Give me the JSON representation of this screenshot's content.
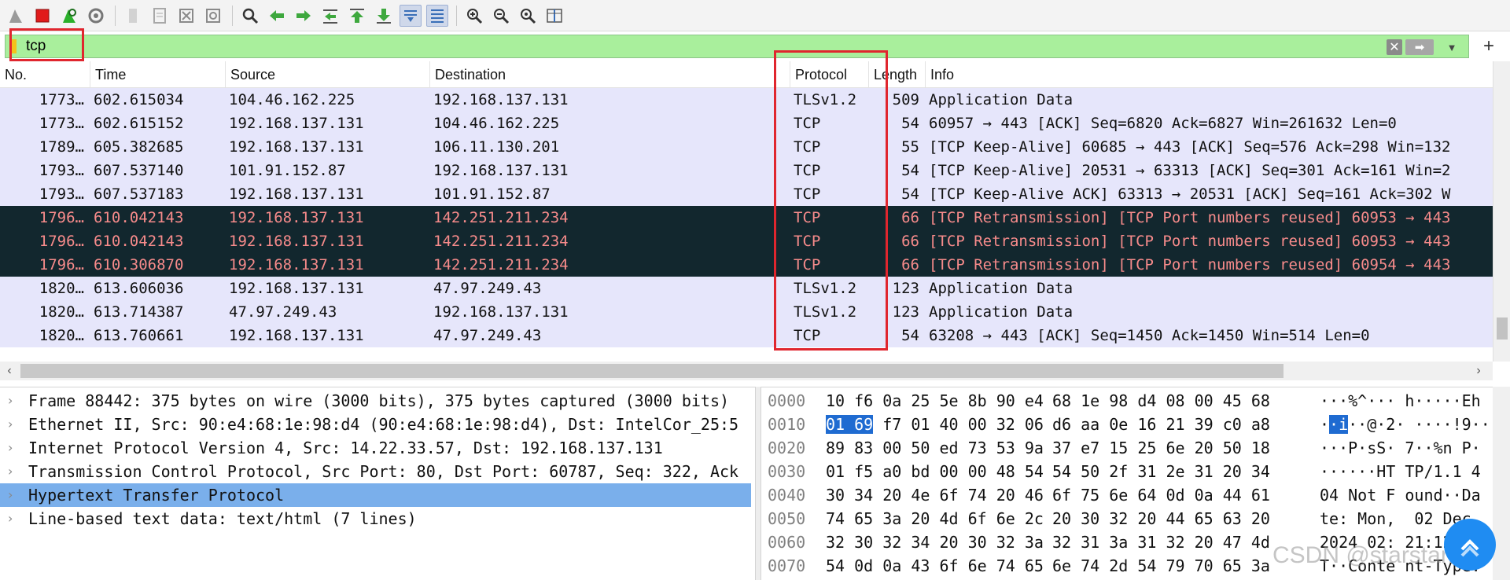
{
  "toolbar": {
    "buttons": [
      {
        "name": "shark-fin-start-icon",
        "color": "#9a9a9a"
      },
      {
        "name": "stop-capture-icon",
        "color": "#e11b1b"
      },
      {
        "name": "restart-capture-icon",
        "color": "#2bb02b"
      },
      {
        "name": "capture-options-icon",
        "color": "#777777"
      },
      {
        "name": "open-file-icon",
        "color": "#b5b5b5"
      },
      {
        "name": "save-file-icon",
        "color": "#b5b5b5"
      },
      {
        "name": "close-file-icon",
        "color": "#8a8a8a"
      },
      {
        "name": "reload-file-icon",
        "color": "#8a8a8a"
      },
      {
        "name": "find-packet-icon",
        "color": "#333333"
      },
      {
        "name": "go-back-icon",
        "color": "#3ea83e"
      },
      {
        "name": "go-forward-icon",
        "color": "#3ea83e"
      },
      {
        "name": "go-to-packet-icon",
        "color": "#3ea83e"
      },
      {
        "name": "go-first-icon",
        "color": "#3ea83e"
      },
      {
        "name": "go-last-icon",
        "color": "#3ea83e"
      },
      {
        "name": "auto-scroll-icon",
        "color": "#3a6fb8"
      },
      {
        "name": "colorize-icon",
        "color": "#3a6fb8"
      },
      {
        "name": "zoom-in-icon",
        "color": "#333333"
      },
      {
        "name": "zoom-out-icon",
        "color": "#333333"
      },
      {
        "name": "zoom-reset-icon",
        "color": "#333333"
      },
      {
        "name": "resize-columns-icon",
        "color": "#3a6fb8"
      }
    ]
  },
  "filter": {
    "value": "tcp",
    "plus": "+"
  },
  "packet_list": {
    "columns": [
      "No.",
      "Time",
      "Source",
      "Destination",
      "Protocol",
      "Length",
      "Info"
    ],
    "rows": [
      {
        "no": "1773…",
        "time": "602.615034",
        "source": "104.46.162.225",
        "destination": "192.168.137.131",
        "protocol": "TLSv1.2",
        "length": "509",
        "info": "Application Data",
        "style": "normal"
      },
      {
        "no": "1773…",
        "time": "602.615152",
        "source": "192.168.137.131",
        "destination": "104.46.162.225",
        "protocol": "TCP",
        "length": "54",
        "info": "60957 → 443 [ACK] Seq=6820 Ack=6827 Win=261632 Len=0",
        "style": "normal"
      },
      {
        "no": "1789…",
        "time": "605.382685",
        "source": "192.168.137.131",
        "destination": "106.11.130.201",
        "protocol": "TCP",
        "length": "55",
        "info": "[TCP Keep-Alive] 60685 → 443 [ACK] Seq=576 Ack=298 Win=132",
        "style": "normal"
      },
      {
        "no": "1793…",
        "time": "607.537140",
        "source": "101.91.152.87",
        "destination": "192.168.137.131",
        "protocol": "TCP",
        "length": "54",
        "info": "[TCP Keep-Alive] 20531 → 63313 [ACK] Seq=301 Ack=161 Win=2",
        "style": "normal"
      },
      {
        "no": "1793…",
        "time": "607.537183",
        "source": "192.168.137.131",
        "destination": "101.91.152.87",
        "protocol": "TCP",
        "length": "54",
        "info": "[TCP Keep-Alive ACK] 63313 → 20531 [ACK] Seq=161 Ack=302 W",
        "style": "normal"
      },
      {
        "no": "1796…",
        "time": "610.042143",
        "source": "192.168.137.131",
        "destination": "142.251.211.234",
        "protocol": "TCP",
        "length": "66",
        "info": "[TCP Retransmission] [TCP Port numbers reused] 60953 → 443",
        "style": "retrans"
      },
      {
        "no": "1796…",
        "time": "610.042143",
        "source": "192.168.137.131",
        "destination": "142.251.211.234",
        "protocol": "TCP",
        "length": "66",
        "info": "[TCP Retransmission] [TCP Port numbers reused] 60953 → 443",
        "style": "retrans"
      },
      {
        "no": "1796…",
        "time": "610.306870",
        "source": "192.168.137.131",
        "destination": "142.251.211.234",
        "protocol": "TCP",
        "length": "66",
        "info": "[TCP Retransmission] [TCP Port numbers reused] 60954 → 443",
        "style": "retrans"
      },
      {
        "no": "1820…",
        "time": "613.606036",
        "source": "192.168.137.131",
        "destination": "47.97.249.43",
        "protocol": "TLSv1.2",
        "length": "123",
        "info": "Application Data",
        "style": "normal"
      },
      {
        "no": "1820…",
        "time": "613.714387",
        "source": "47.97.249.43",
        "destination": "192.168.137.131",
        "protocol": "TLSv1.2",
        "length": "123",
        "info": "Application Data",
        "style": "normal"
      },
      {
        "no": "1820…",
        "time": "613.760661",
        "source": "192.168.137.131",
        "destination": "47.97.249.43",
        "protocol": "TCP",
        "length": "54",
        "info": "63208 → 443 [ACK] Seq=1450 Ack=1450 Win=514 Len=0",
        "style": "normal"
      }
    ],
    "scroll_left": "‹",
    "scroll_right": "›"
  },
  "details": {
    "rows": [
      {
        "text": "Frame 88442: 375 bytes on wire (3000 bits), 375 bytes captured (3000 bits)",
        "selected": false
      },
      {
        "text": "Ethernet II, Src: 90:e4:68:1e:98:d4 (90:e4:68:1e:98:d4), Dst: IntelCor_25:5",
        "selected": false
      },
      {
        "text": "Internet Protocol Version 4, Src: 14.22.33.57, Dst: 192.168.137.131",
        "selected": false
      },
      {
        "text": "Transmission Control Protocol, Src Port: 80, Dst Port: 60787, Seq: 322, Ack",
        "selected": false
      },
      {
        "text": "Hypertext Transfer Protocol",
        "selected": true
      },
      {
        "text": "Line-based text data: text/html (7 lines)",
        "selected": false
      }
    ],
    "chevron": "›"
  },
  "bytes": {
    "rows": [
      {
        "offset": "0000",
        "hex1": "10 f6 0a 25 5e 8b 90 e4",
        "hex2": "68 1e 98 d4 08 00 45 68",
        "ascii": "···%^··· h·····Eh"
      },
      {
        "offset": "0010",
        "hex_hl": "01 69",
        "hex1_rest": " f7 01 40 00 32 06",
        "hex2": "d6 aa 0e 16 21 39 c0 a8",
        "ascii_pre": "·",
        "ascii_hl": "·i",
        "ascii_rest": "··@·2· ····!9··"
      },
      {
        "offset": "0020",
        "hex1": "89 83 00 50 ed 73 53 9a",
        "hex2": "37 e7 15 25 6e 20 50 18",
        "ascii": "···P·sS· 7··%n P·"
      },
      {
        "offset": "0030",
        "hex1": "01 f5 a0 bd 00 00 48 54",
        "hex2": "54 50 2f 31 2e 31 20 34",
        "ascii": "······HT TP/1.1 4"
      },
      {
        "offset": "0040",
        "hex1": "30 34 20 4e 6f 74 20 46",
        "hex2": "6f 75 6e 64 0d 0a 44 61",
        "ascii": "04 Not F ound··Da"
      },
      {
        "offset": "0050",
        "hex1": "74 65 3a 20 4d 6f 6e 2c",
        "hex2": "20 30 32 20 44 65 63 20",
        "ascii": "te: Mon,  02 Dec "
      },
      {
        "offset": "0060",
        "hex1": "32 30 32 34 20 30 32 3a",
        "hex2": "32 31 3a 31 32 20 47 4d",
        "ascii": "2024 02: 21:12 GM"
      },
      {
        "offset": "0070",
        "hex1": "54 0d 0a 43 6f 6e 74 65",
        "hex2": "6e 74 2d 54 79 70 65 3a",
        "ascii": "T··Conte nt-Type:"
      }
    ]
  },
  "watermark": "CSDN @starstarzz",
  "colors": {
    "filter_bg": "#a9ef9c",
    "row_normal": "#e6e6fb",
    "row_retrans_bg": "#12272e",
    "row_retrans_fg": "#f78b8b",
    "selection": "#7aafeb",
    "highlight_box": "#e0262e"
  }
}
